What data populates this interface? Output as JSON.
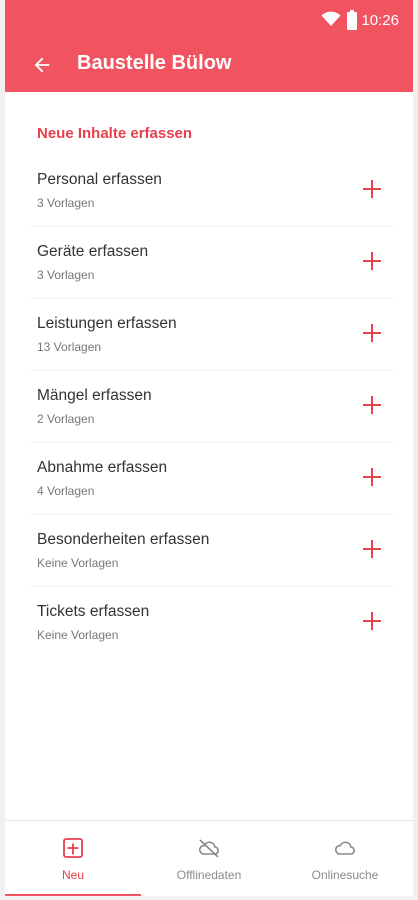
{
  "status": {
    "time": "10:26"
  },
  "appbar": {
    "title": "Baustelle Bülow"
  },
  "section": {
    "title": "Neue Inhalte erfassen"
  },
  "items": [
    {
      "label": "Personal erfassen",
      "sub": "3 Vorlagen"
    },
    {
      "label": "Geräte erfassen",
      "sub": "3 Vorlagen"
    },
    {
      "label": "Leistungen erfassen",
      "sub": "13 Vorlagen"
    },
    {
      "label": "Mängel erfassen",
      "sub": "2 Vorlagen"
    },
    {
      "label": "Abnahme erfassen",
      "sub": "4 Vorlagen"
    },
    {
      "label": "Besonderheiten erfassen",
      "sub": "Keine Vorlagen"
    },
    {
      "label": "Tickets erfassen",
      "sub": "Keine Vorlagen"
    }
  ],
  "nav": [
    {
      "label": "Neu",
      "icon": "add-box-icon",
      "active": true
    },
    {
      "label": "Offlinedaten",
      "icon": "cloud-off-icon",
      "active": false
    },
    {
      "label": "Onlinesuche",
      "icon": "cloud-icon",
      "active": false
    }
  ],
  "colors": {
    "accent": "#f15460",
    "accent_text": "#e8404e"
  }
}
